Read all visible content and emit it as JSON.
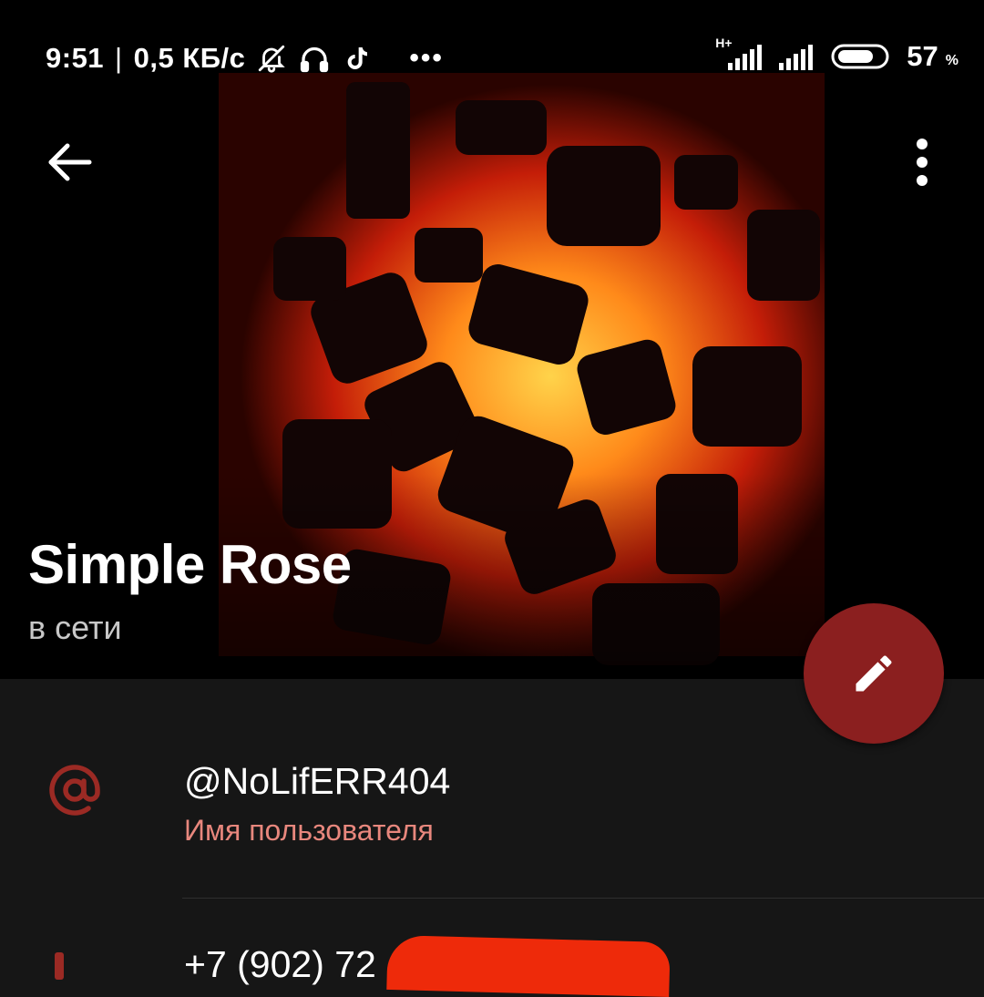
{
  "status_bar": {
    "time": "9:51",
    "separator": "|",
    "speed": "0,5 КБ/с",
    "icons": [
      "bell-off-icon",
      "headphones-icon",
      "tiktok-icon",
      "more-notifications-icon"
    ],
    "network_type": "H+",
    "battery": "57",
    "battery_unit": "%"
  },
  "toolbar": {
    "back_icon": "arrow-left-icon",
    "menu_icon": "more-vertical-icon"
  },
  "profile": {
    "name": "Simple Rose",
    "status": "в сети",
    "edit_icon": "pencil-icon"
  },
  "info": {
    "username": "@NoLifERR404",
    "username_label": "Имя пользователя",
    "phone_partial": "+7 (902) 72",
    "username_icon": "at-icon",
    "phone_icon": "phone-icon"
  },
  "colors": {
    "accent": "#8b1f1f",
    "label": "#e8877d",
    "background": "#161616",
    "redaction": "#ee2a0a"
  }
}
